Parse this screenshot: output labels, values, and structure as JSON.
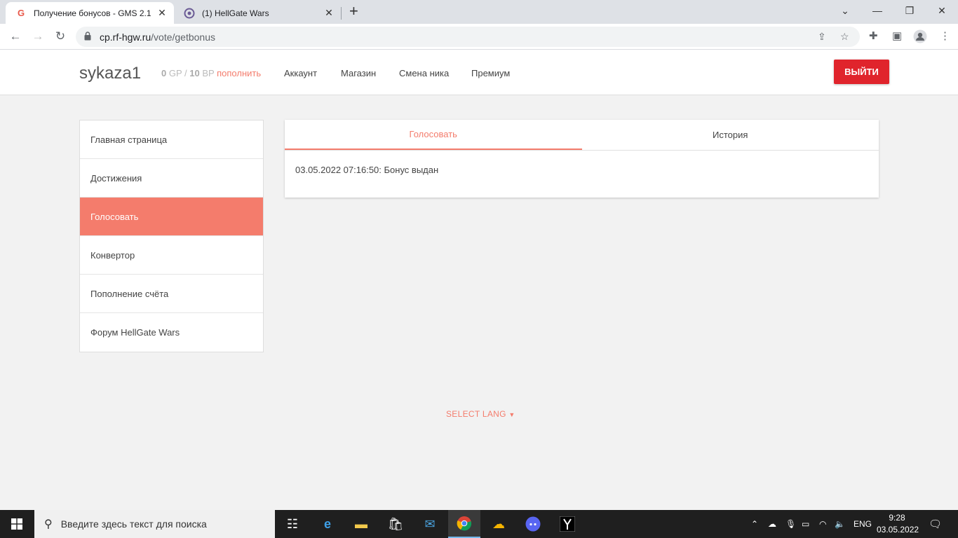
{
  "browser": {
    "tabs": [
      {
        "title": "Получение бонусов - GMS 2.1",
        "active": true
      },
      {
        "title": "(1) HellGate Wars",
        "active": false
      }
    ],
    "url_host": "cp.rf-hgw.ru",
    "url_path": "/vote/getbonus"
  },
  "header": {
    "username": "sykaza1",
    "gp_value": "0",
    "gp_unit": "GP",
    "separator": "/",
    "bp_value": "10",
    "bp_unit": "BP",
    "topup": "пополнить",
    "nav": [
      "Аккаунт",
      "Магазин",
      "Смена ника",
      "Премиум"
    ],
    "logout": "ВЫЙТИ"
  },
  "sidebar": {
    "items": [
      {
        "label": "Главная страница",
        "active": false
      },
      {
        "label": "Достижения",
        "active": false
      },
      {
        "label": "Голосовать",
        "active": true
      },
      {
        "label": "Конвертор",
        "active": false
      },
      {
        "label": "Пополнение счёта",
        "active": false
      },
      {
        "label": "Форум HellGate Wars",
        "active": false
      }
    ]
  },
  "panel": {
    "tabs": [
      {
        "label": "Голосовать",
        "active": true
      },
      {
        "label": "История",
        "active": false
      }
    ],
    "entry": "03.05.2022 07:16:50: Бонус выдан"
  },
  "footer": {
    "select_lang": "SELECT LANG"
  },
  "taskbar": {
    "search_placeholder": "Введите здесь текст для поиска",
    "lang": "ENG",
    "time": "9:28",
    "date": "03.05.2022"
  },
  "colors": {
    "accent": "#f47c6c",
    "logout": "#e0242c"
  }
}
